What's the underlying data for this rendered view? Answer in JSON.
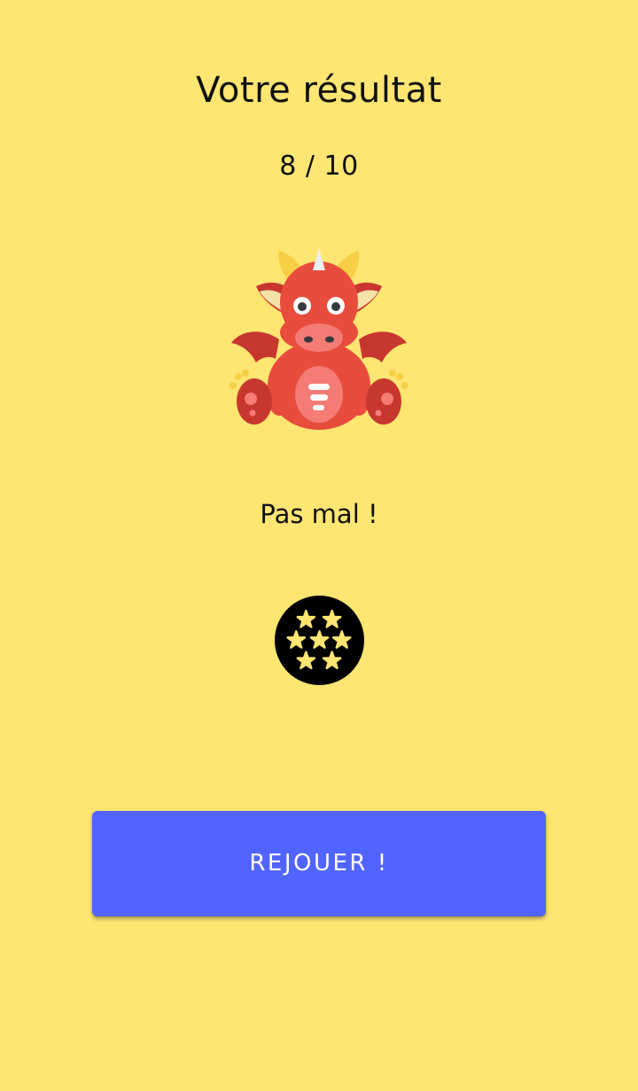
{
  "result": {
    "title": "Votre résultat",
    "score": "8 / 10",
    "message": "Pas mal !"
  },
  "illustration": {
    "icon": "dragon-icon"
  },
  "badge": {
    "icon": "seven-stars-icon",
    "star_count": 7
  },
  "actions": {
    "replay_label": "REJOUER !"
  },
  "colors": {
    "background": "#FFE572",
    "button": "#5264FF",
    "button_text": "#FFFFFF",
    "text": "#111111",
    "badge_background": "#000000",
    "star": "#FFE572"
  }
}
